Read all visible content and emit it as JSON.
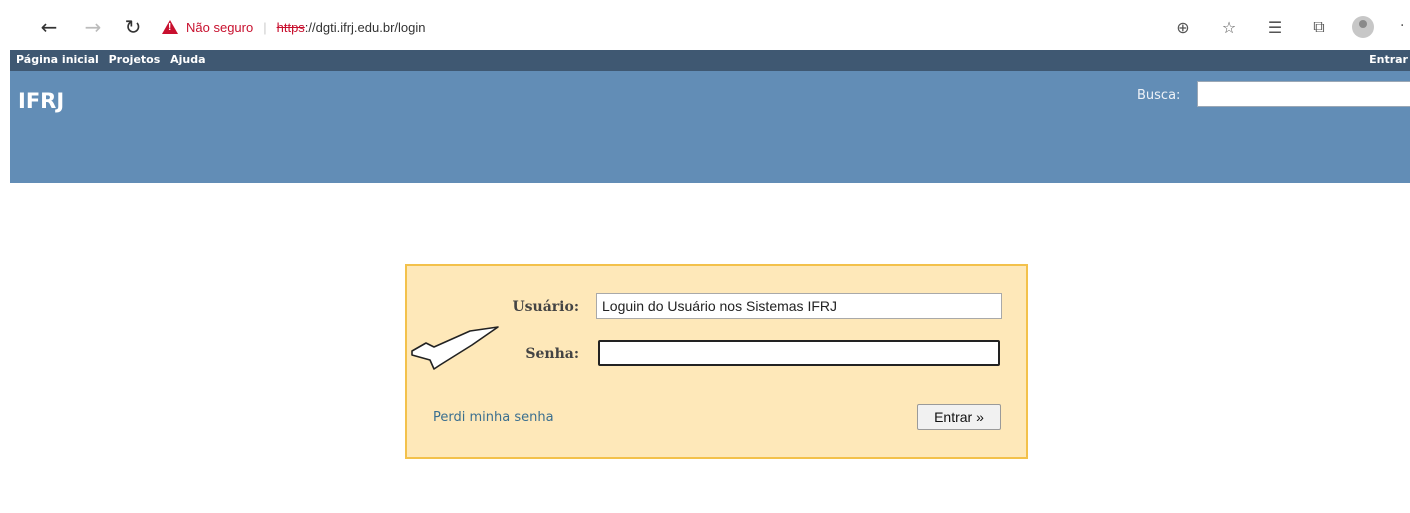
{
  "browser": {
    "not_secure_label": "Não seguro",
    "url_scheme": "https",
    "url_rest": "://dgti.ifrj.edu.br/login",
    "icons": [
      "back-arrow-icon",
      "forward-arrow-icon",
      "refresh-icon",
      "warning-icon",
      "zoom-icon",
      "favorite-add-icon",
      "favorites-icon",
      "collections-icon",
      "profile-icon",
      "more-icon"
    ]
  },
  "top_menu": {
    "items": [
      "Página inicial",
      "Projetos",
      "Ajuda"
    ],
    "login_link": "Entrar"
  },
  "header": {
    "title": "IFRJ",
    "search_label": "Busca:",
    "search_value": ""
  },
  "login_form": {
    "user_label": "Usuário:",
    "user_value": "Loguin do Usuário nos Sistemas IFRJ",
    "password_label": "Senha:",
    "password_value": "",
    "lost_password_link": "Perdi minha senha",
    "submit_label": "Entrar »"
  },
  "colors": {
    "top_menu_bg": "#3f5872",
    "header_bg": "#628db6",
    "login_box_bg": "#fee8b9",
    "login_box_border": "#f3c14b",
    "warning": "#c8102e"
  }
}
